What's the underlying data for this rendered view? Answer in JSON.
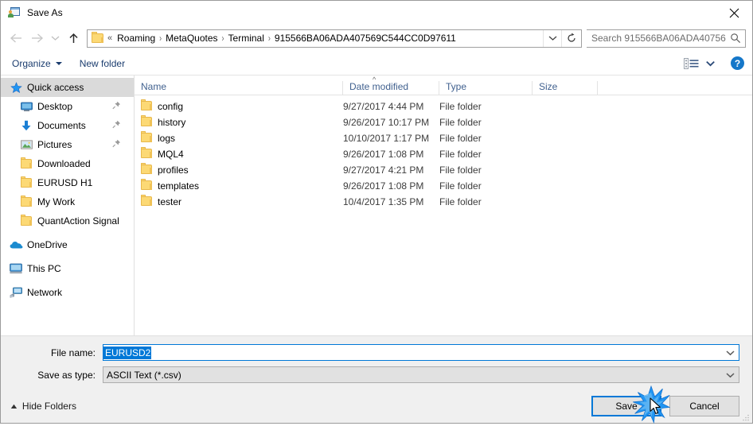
{
  "window": {
    "title": "Save As",
    "icon": "save-as-icon",
    "close_label": "✕"
  },
  "nav": {
    "back_icon": "back-arrow-icon",
    "forward_icon": "forward-arrow-icon",
    "history_icon": "chevron-down-icon",
    "up_icon": "up-arrow-icon",
    "breadcrumb_prefix": "«",
    "breadcrumbs": [
      "Roaming",
      "MetaQuotes",
      "Terminal",
      "915566BA06ADA407569C544CC0D97611"
    ],
    "breadcrumb_separator": "›",
    "dropdown_icon": "chevron-down-icon",
    "refresh_icon": "refresh-icon"
  },
  "search": {
    "placeholder": "Search 915566BA06ADA40756...",
    "icon": "search-icon"
  },
  "toolbar": {
    "organize_label": "Organize",
    "new_folder_label": "New folder",
    "view_icon": "view-options-icon",
    "view_caret_icon": "chevron-down-icon",
    "help_label": "?",
    "help_icon": "help-icon"
  },
  "sidebar": {
    "items": [
      {
        "label": "Quick access",
        "icon": "star-icon",
        "selected": true,
        "indent": false,
        "pinned": false,
        "group": false
      },
      {
        "label": "Desktop",
        "icon": "desktop-icon",
        "selected": false,
        "indent": true,
        "pinned": true,
        "group": false
      },
      {
        "label": "Documents",
        "icon": "documents-icon",
        "selected": false,
        "indent": true,
        "pinned": true,
        "group": false
      },
      {
        "label": "Pictures",
        "icon": "pictures-icon",
        "selected": false,
        "indent": true,
        "pinned": true,
        "group": false
      },
      {
        "label": "Downloaded",
        "icon": "folder-icon",
        "selected": false,
        "indent": true,
        "pinned": false,
        "group": false
      },
      {
        "label": "EURUSD H1",
        "icon": "folder-icon",
        "selected": false,
        "indent": true,
        "pinned": false,
        "group": false
      },
      {
        "label": "My Work",
        "icon": "folder-icon",
        "selected": false,
        "indent": true,
        "pinned": false,
        "group": false
      },
      {
        "label": "QuantAction Signal",
        "icon": "folder-icon",
        "selected": false,
        "indent": true,
        "pinned": false,
        "group": false
      },
      {
        "label": "OneDrive",
        "icon": "onedrive-icon",
        "selected": false,
        "indent": false,
        "pinned": false,
        "group": true
      },
      {
        "label": "This PC",
        "icon": "this-pc-icon",
        "selected": false,
        "indent": false,
        "pinned": false,
        "group": true
      },
      {
        "label": "Network",
        "icon": "network-icon",
        "selected": false,
        "indent": false,
        "pinned": false,
        "group": true
      }
    ]
  },
  "filelist": {
    "columns": [
      "Name",
      "Date modified",
      "Type",
      "Size"
    ],
    "sort_column": "Name",
    "sort_indicator": "^",
    "rows": [
      {
        "name": "config",
        "date": "9/27/2017 4:44 PM",
        "type": "File folder",
        "size": ""
      },
      {
        "name": "history",
        "date": "9/26/2017 10:17 PM",
        "type": "File folder",
        "size": ""
      },
      {
        "name": "logs",
        "date": "10/10/2017 1:17 PM",
        "type": "File folder",
        "size": ""
      },
      {
        "name": "MQL4",
        "date": "9/26/2017 1:08 PM",
        "type": "File folder",
        "size": ""
      },
      {
        "name": "profiles",
        "date": "9/27/2017 4:21 PM",
        "type": "File folder",
        "size": ""
      },
      {
        "name": "templates",
        "date": "9/26/2017 1:08 PM",
        "type": "File folder",
        "size": ""
      },
      {
        "name": "tester",
        "date": "10/4/2017 1:35 PM",
        "type": "File folder",
        "size": ""
      }
    ]
  },
  "form": {
    "file_name_label": "File name:",
    "file_name_value": "EURUSD2",
    "save_as_type_label": "Save as type:",
    "save_as_type_value": "ASCII Text (*.csv)",
    "dropdown_icon": "chevron-down-icon"
  },
  "footer": {
    "hide_folders_label": "Hide Folders",
    "hide_folders_icon": "chevron-up-icon",
    "save_label": "Save",
    "cancel_label": "Cancel"
  },
  "colors": {
    "accent": "#0078d7",
    "folder": "#fcd975",
    "link_text": "#1a3c6e",
    "column_header_text": "#41618f",
    "panel_bg": "#f0f0f0"
  }
}
